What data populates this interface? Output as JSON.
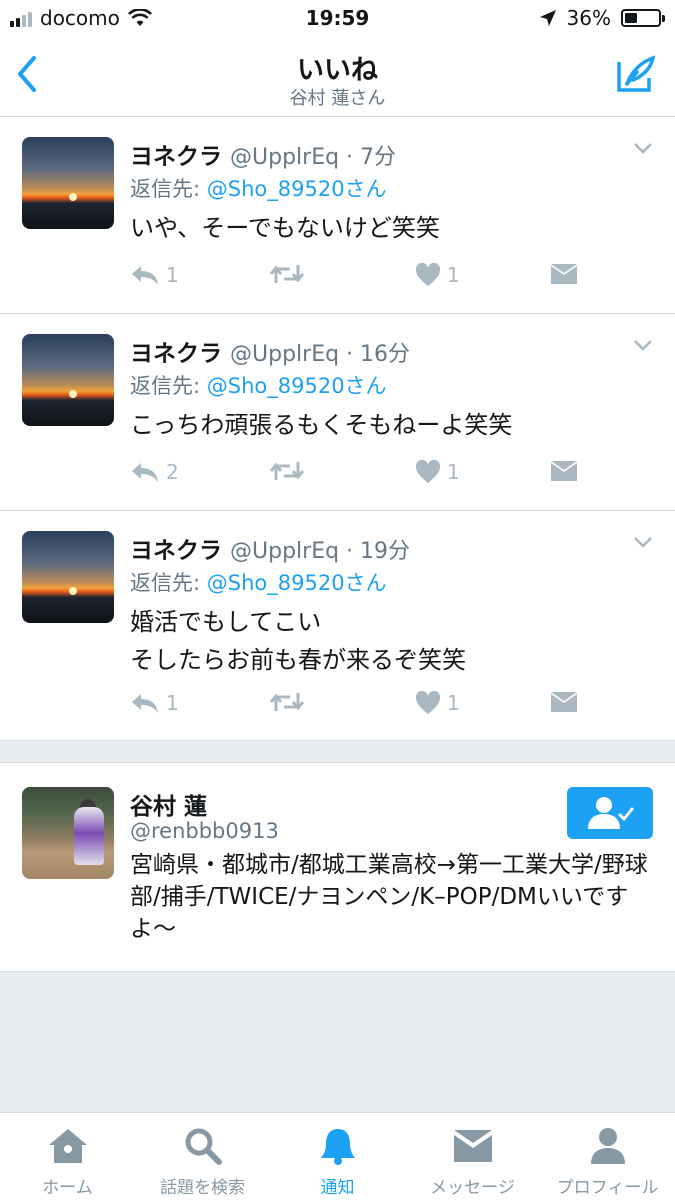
{
  "status_bar": {
    "carrier": "docomo",
    "time": "19:59",
    "battery": "36%",
    "battery_level": 0.36
  },
  "nav": {
    "title": "いいね",
    "subtitle": "谷村 蓮さん"
  },
  "tweets": [
    {
      "name": "ヨネクラ",
      "meta": "@UpplrEq · 7分",
      "reply_prefix": "返信先: ",
      "reply_to": "@Sho_89520さん",
      "text": "いや、そーでもないけど笑笑",
      "replies": "1",
      "retweets": "",
      "likes": "1"
    },
    {
      "name": "ヨネクラ",
      "meta": "@UpplrEq · 16分",
      "reply_prefix": "返信先: ",
      "reply_to": "@Sho_89520さん",
      "text": "こっちわ頑張るもくそもねーよ笑笑",
      "replies": "2",
      "retweets": "",
      "likes": "1"
    },
    {
      "name": "ヨネクラ",
      "meta": "@UpplrEq · 19分",
      "reply_prefix": "返信先: ",
      "reply_to": "@Sho_89520さん",
      "text": "婚活でもしてこい\nそしたらお前も春が来るぞ笑笑",
      "replies": "1",
      "retweets": "",
      "likes": "1"
    }
  ],
  "profile": {
    "name": "谷村 蓮",
    "handle": "@renbbb0913",
    "bio": "宮崎県・都城市/都城工業高校→第一工業大学/野球部/捕手/TWICE/ナヨンペン/K–POP/DMいいですよ〜"
  },
  "tabs": [
    {
      "label": "ホーム",
      "icon": "home-icon"
    },
    {
      "label": "話題を検索",
      "icon": "search-icon"
    },
    {
      "label": "通知",
      "icon": "bell-icon"
    },
    {
      "label": "メッセージ",
      "icon": "envelope-icon"
    },
    {
      "label": "プロフィール",
      "icon": "person-icon"
    }
  ],
  "colors": {
    "accent": "#1da1f2",
    "muted": "#657786",
    "action": "#aab8c2",
    "background": "#e6ecf0"
  }
}
